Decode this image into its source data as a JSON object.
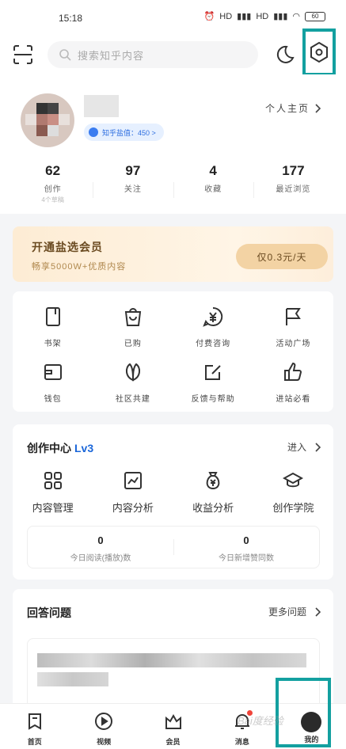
{
  "status_bar": {
    "time": "15:18",
    "indicators": [
      "alarm-icon",
      "HD",
      "HD",
      "wifi-icon"
    ],
    "battery": "60"
  },
  "top_bar": {
    "search_placeholder": "搜索知乎内容"
  },
  "profile": {
    "badge": "知乎盐值：450 >",
    "home_link": "个人主页",
    "stats": [
      {
        "num": "62",
        "label": "创作",
        "sub": "4个草稿"
      },
      {
        "num": "97",
        "label": "关注",
        "sub": ""
      },
      {
        "num": "4",
        "label": "收藏",
        "sub": ""
      },
      {
        "num": "177",
        "label": "最近浏览",
        "sub": ""
      }
    ]
  },
  "vip": {
    "title": "开通盐选会员",
    "subtitle": "畅享5000W+优质内容",
    "price": "仅0.3元/天"
  },
  "grid": [
    {
      "label": "书架",
      "icon": "bookshelf-icon"
    },
    {
      "label": "已购",
      "icon": "bag-icon"
    },
    {
      "label": "付费咨询",
      "icon": "yen-icon"
    },
    {
      "label": "活动广场",
      "icon": "flag-icon"
    },
    {
      "label": "钱包",
      "icon": "wallet-icon"
    },
    {
      "label": "社区共建",
      "icon": "leaf-icon"
    },
    {
      "label": "反馈与帮助",
      "icon": "edit-icon"
    },
    {
      "label": "进站必看",
      "icon": "thumb-icon"
    }
  ],
  "create": {
    "title": "创作中心",
    "level": "Lv3",
    "enter": "进入",
    "items": [
      {
        "label": "内容管理",
        "icon": "grid-icon"
      },
      {
        "label": "内容分析",
        "icon": "chart-icon"
      },
      {
        "label": "收益分析",
        "icon": "money-bag-icon"
      },
      {
        "label": "创作学院",
        "icon": "graduation-cap-icon"
      }
    ],
    "today": [
      {
        "num": "0",
        "label": "今日阅读(播放)数"
      },
      {
        "num": "0",
        "label": "今日新增赞同数"
      }
    ]
  },
  "answer": {
    "title": "回答问题",
    "more": "更多问题"
  },
  "tabs": [
    {
      "label": "首页",
      "icon": "home-icon"
    },
    {
      "label": "视频",
      "icon": "play-icon"
    },
    {
      "label": "会员",
      "icon": "crown-icon"
    },
    {
      "label": "消息",
      "icon": "bell-icon"
    },
    {
      "label": "我的",
      "icon": "avatar-icon"
    }
  ],
  "watermark": "Bai度经验"
}
